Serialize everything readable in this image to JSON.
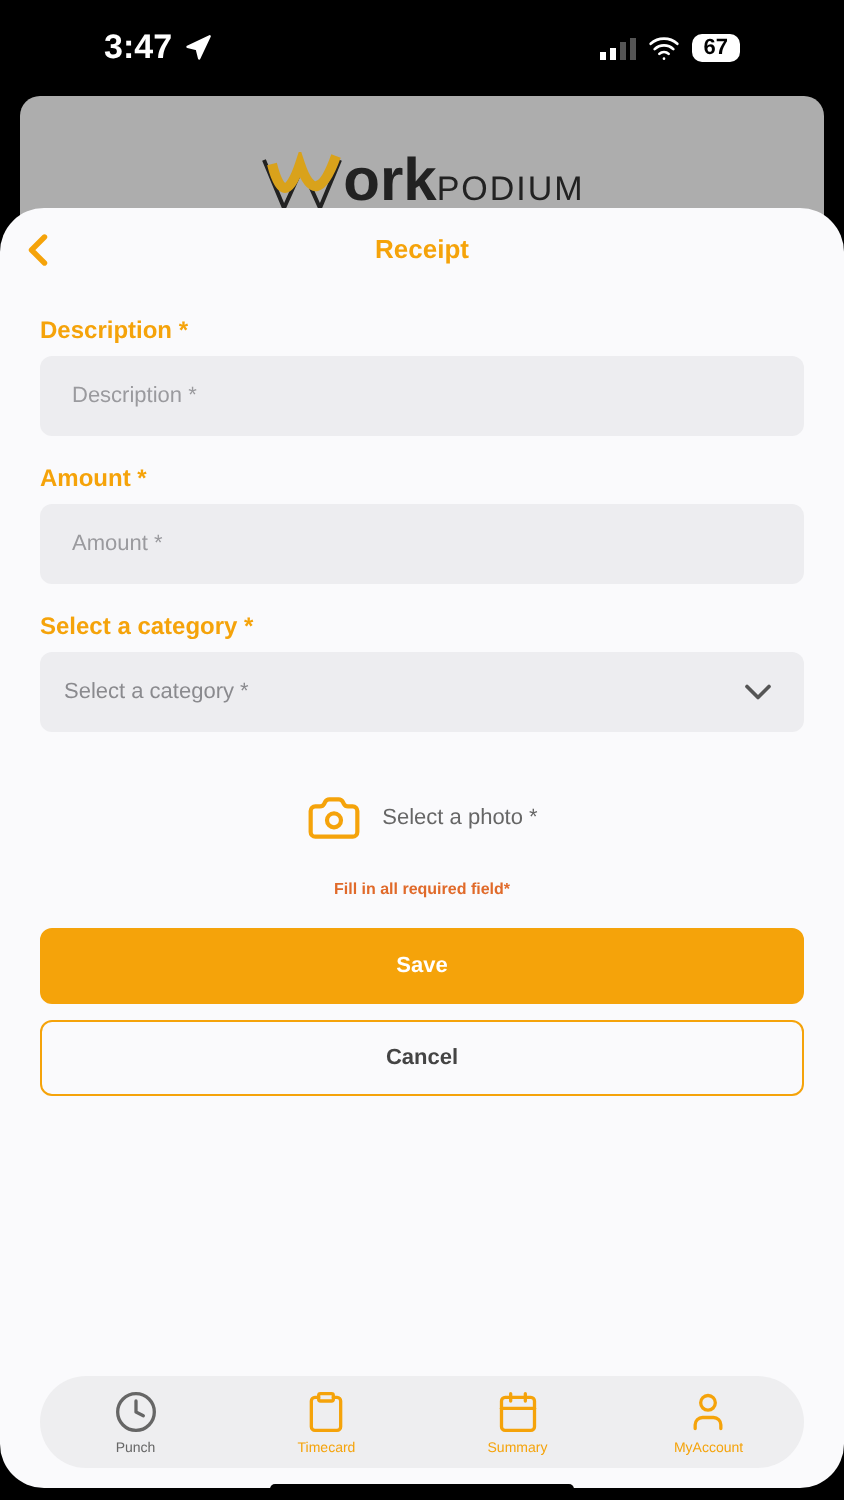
{
  "status_bar": {
    "time": "3:47",
    "battery": "67"
  },
  "logo": {
    "text": "ork",
    "subtext": "PODIUM"
  },
  "header": {
    "title": "Receipt"
  },
  "fields": [
    {
      "kind": "text",
      "label": "Description *",
      "placeholder": "Description *"
    },
    {
      "kind": "text",
      "label": "Amount *",
      "placeholder": "Amount *"
    },
    {
      "kind": "select",
      "label": "Select a category *",
      "placeholder": "Select a category *"
    }
  ],
  "photo": {
    "label": "Select a photo *"
  },
  "error": "Fill in all required field*",
  "buttons": [
    {
      "kind": "primary",
      "label": "Save"
    },
    {
      "kind": "secondary",
      "label": "Cancel"
    }
  ],
  "tabs": [
    {
      "kind": "punch",
      "label": "Punch",
      "disabled": true
    },
    {
      "kind": "timecard",
      "label": "Timecard",
      "disabled": false
    },
    {
      "kind": "summary",
      "label": "Summary",
      "disabled": false
    },
    {
      "kind": "account",
      "label": "MyAccount",
      "disabled": false
    }
  ]
}
